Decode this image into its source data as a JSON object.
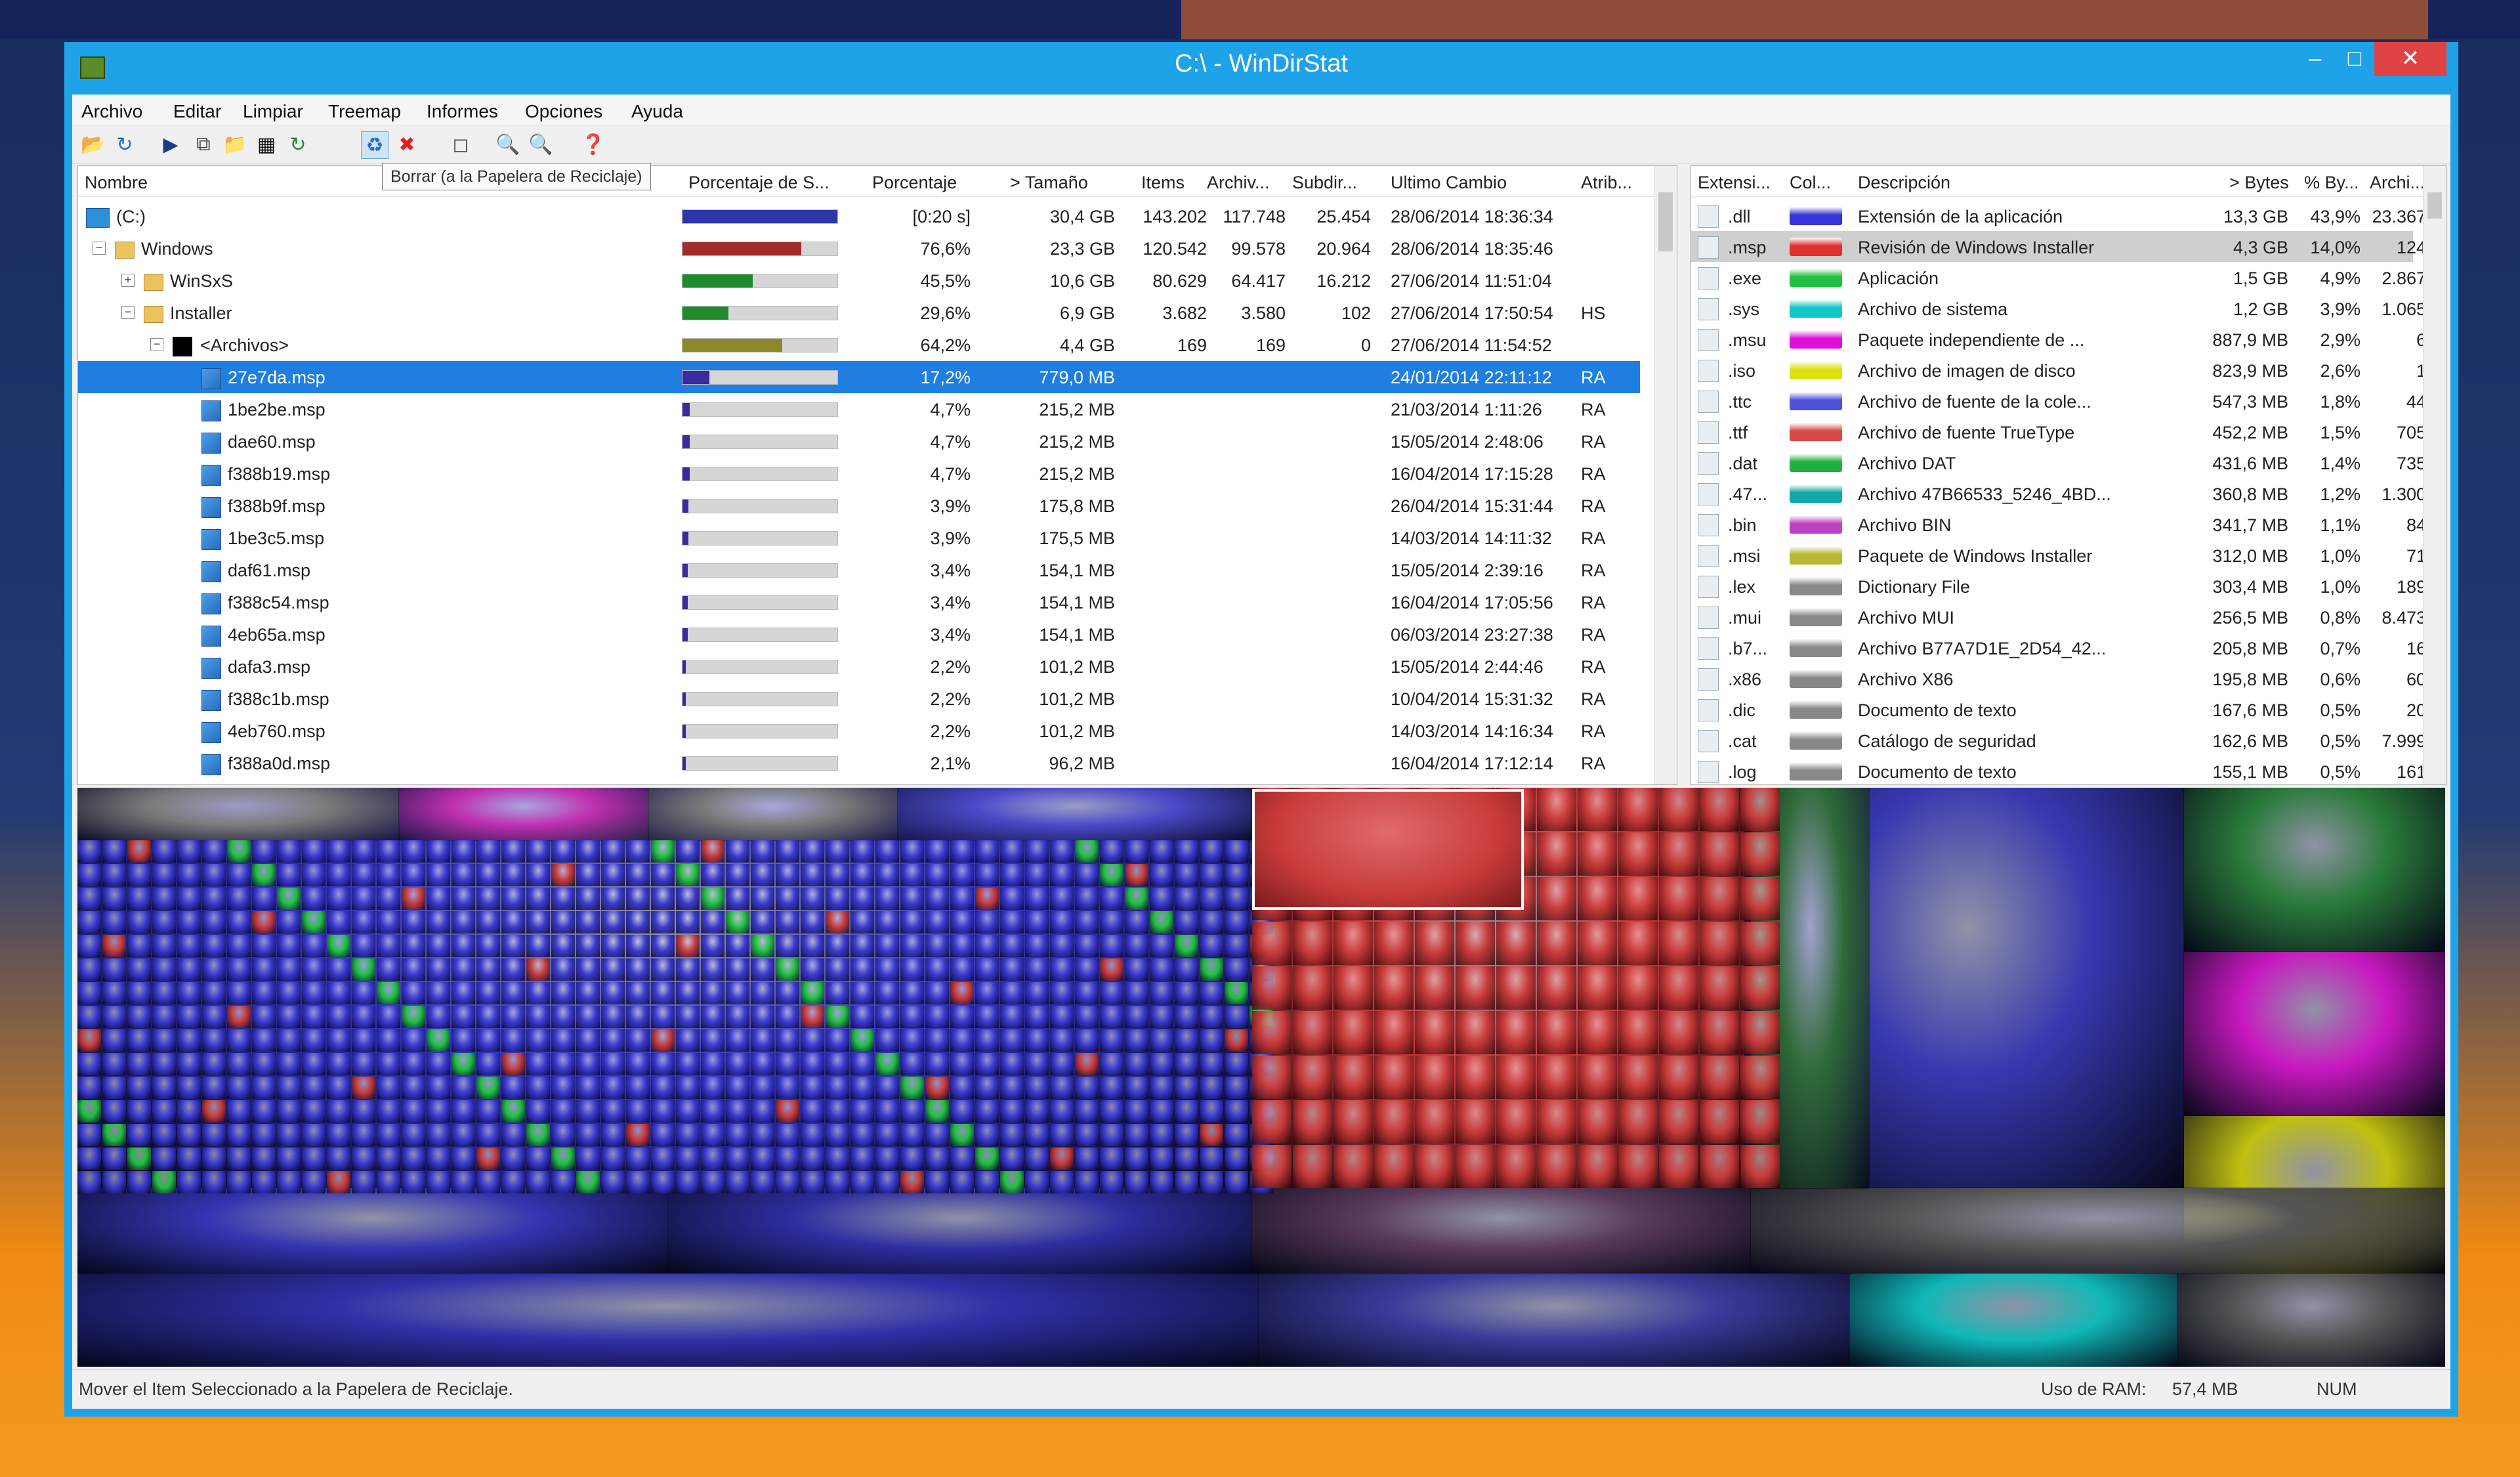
{
  "window": {
    "title": "C:\\ - WinDirStat"
  },
  "menu": [
    "Archivo",
    "Editar",
    "Limpiar",
    "Treemap",
    "Informes",
    "Opciones",
    "Ayuda"
  ],
  "toolbar": {
    "icons": [
      "open-icon",
      "refresh-icon",
      "play-icon",
      "copy-path-icon",
      "explorer-icon",
      "cmd-icon",
      "refresh-selected-icon",
      "recycle-bin-icon",
      "delete-icon",
      "properties-icon",
      "zoom-in-icon",
      "zoom-out-icon",
      "help-icon"
    ],
    "tooltip": "Borrar (a la Papelera de Reciclaje)"
  },
  "tree": {
    "columns": [
      "Nombre",
      "Porcentaje de S...",
      "Porcentaje",
      "> Tamaño",
      "Items",
      "Archiv...",
      "Subdir...",
      "Ultimo Cambio",
      "Atrib..."
    ],
    "rows": [
      {
        "name": "(C:)",
        "pct": "[0:20 s]",
        "size": "30,4 GB",
        "items": "143.202",
        "files": "117.748",
        "subdirs": "25.454",
        "date": "28/06/2014  18:36:34",
        "attr": "",
        "bar": 1.0,
        "color": "#2e35a8"
      },
      {
        "name": "Windows",
        "pct": "76,6%",
        "size": "23,3 GB",
        "items": "120.542",
        "files": "99.578",
        "subdirs": "20.964",
        "date": "28/06/2014  18:35:46",
        "attr": "",
        "bar": 0.766,
        "color": "#a02c2c"
      },
      {
        "name": "WinSxS",
        "pct": "45,5%",
        "size": "10,6 GB",
        "items": "80.629",
        "files": "64.417",
        "subdirs": "16.212",
        "date": "27/06/2014  11:51:04",
        "attr": "",
        "bar": 0.455,
        "color": "#1f8a2e"
      },
      {
        "name": "Installer",
        "pct": "29,6%",
        "size": "6,9 GB",
        "items": "3.682",
        "files": "3.580",
        "subdirs": "102",
        "date": "27/06/2014  17:50:54",
        "attr": "HS",
        "bar": 0.296,
        "color": "#1f8a2e"
      },
      {
        "name": "<Archivos>",
        "pct": "64,2%",
        "size": "4,4 GB",
        "items": "169",
        "files": "169",
        "subdirs": "0",
        "date": "27/06/2014  11:54:52",
        "attr": "",
        "bar": 0.642,
        "color": "#8a8a2a"
      },
      {
        "name": "27e7da.msp",
        "pct": "17,2%",
        "size": "779,0 MB",
        "items": "",
        "files": "",
        "subdirs": "",
        "date": "24/01/2014  22:11:12",
        "attr": "RA",
        "bar": 0.172,
        "color": "#3a2aa0"
      },
      {
        "name": "1be2be.msp",
        "pct": "4,7%",
        "size": "215,2 MB",
        "items": "",
        "files": "",
        "subdirs": "",
        "date": "21/03/2014  1:11:26",
        "attr": "RA",
        "bar": 0.047,
        "color": "#3a2aa0"
      },
      {
        "name": "dae60.msp",
        "pct": "4,7%",
        "size": "215,2 MB",
        "items": "",
        "files": "",
        "subdirs": "",
        "date": "15/05/2014  2:48:06",
        "attr": "RA",
        "bar": 0.047,
        "color": "#3a2aa0"
      },
      {
        "name": "f388b19.msp",
        "pct": "4,7%",
        "size": "215,2 MB",
        "items": "",
        "files": "",
        "subdirs": "",
        "date": "16/04/2014  17:15:28",
        "attr": "RA",
        "bar": 0.047,
        "color": "#3a2aa0"
      },
      {
        "name": "f388b9f.msp",
        "pct": "3,9%",
        "size": "175,8 MB",
        "items": "",
        "files": "",
        "subdirs": "",
        "date": "26/04/2014  15:31:44",
        "attr": "RA",
        "bar": 0.039,
        "color": "#3a2aa0"
      },
      {
        "name": "1be3c5.msp",
        "pct": "3,9%",
        "size": "175,5 MB",
        "items": "",
        "files": "",
        "subdirs": "",
        "date": "14/03/2014  14:11:32",
        "attr": "RA",
        "bar": 0.039,
        "color": "#3a2aa0"
      },
      {
        "name": "daf61.msp",
        "pct": "3,4%",
        "size": "154,1 MB",
        "items": "",
        "files": "",
        "subdirs": "",
        "date": "15/05/2014  2:39:16",
        "attr": "RA",
        "bar": 0.034,
        "color": "#3a2aa0"
      },
      {
        "name": "f388c54.msp",
        "pct": "3,4%",
        "size": "154,1 MB",
        "items": "",
        "files": "",
        "subdirs": "",
        "date": "16/04/2014  17:05:56",
        "attr": "RA",
        "bar": 0.034,
        "color": "#3a2aa0"
      },
      {
        "name": "4eb65a.msp",
        "pct": "3,4%",
        "size": "154,1 MB",
        "items": "",
        "files": "",
        "subdirs": "",
        "date": "06/03/2014  23:27:38",
        "attr": "RA",
        "bar": 0.034,
        "color": "#3a2aa0"
      },
      {
        "name": "dafa3.msp",
        "pct": "2,2%",
        "size": "101,2 MB",
        "items": "",
        "files": "",
        "subdirs": "",
        "date": "15/05/2014  2:44:46",
        "attr": "RA",
        "bar": 0.022,
        "color": "#3a2aa0"
      },
      {
        "name": "f388c1b.msp",
        "pct": "2,2%",
        "size": "101,2 MB",
        "items": "",
        "files": "",
        "subdirs": "",
        "date": "10/04/2014  15:31:32",
        "attr": "RA",
        "bar": 0.022,
        "color": "#3a2aa0"
      },
      {
        "name": "4eb760.msp",
        "pct": "2,2%",
        "size": "101,2 MB",
        "items": "",
        "files": "",
        "subdirs": "",
        "date": "14/03/2014  14:16:34",
        "attr": "RA",
        "bar": 0.022,
        "color": "#3a2aa0"
      },
      {
        "name": "f388a0d.msp",
        "pct": "2,1%",
        "size": "96,2 MB",
        "items": "",
        "files": "",
        "subdirs": "",
        "date": "16/04/2014  17:12:14",
        "attr": "RA",
        "bar": 0.021,
        "color": "#3a2aa0"
      }
    ]
  },
  "extensions": {
    "columns": [
      "Extensi...",
      "Col...",
      "Descripción",
      "> Bytes",
      "% By...",
      "Archi..."
    ],
    "rows": [
      {
        "ext": ".dll",
        "desc": "Extensión de la aplicación",
        "bytes": "13,3 GB",
        "pct": "43,9%",
        "files": "23.367",
        "color": "#3434d8"
      },
      {
        "ext": ".msp",
        "desc": "Revisión de Windows Installer",
        "bytes": "4,3 GB",
        "pct": "14,0%",
        "files": "124",
        "color": "#e03030"
      },
      {
        "ext": ".exe",
        "desc": "Aplicación",
        "bytes": "1,5 GB",
        "pct": "4,9%",
        "files": "2.867",
        "color": "#20c040"
      },
      {
        "ext": ".sys",
        "desc": "Archivo de sistema",
        "bytes": "1,2 GB",
        "pct": "3,9%",
        "files": "1.065",
        "color": "#10c8c8"
      },
      {
        "ext": ".msu",
        "desc": "Paquete independiente de ...",
        "bytes": "887,9 MB",
        "pct": "2,9%",
        "files": "6",
        "color": "#e010d8"
      },
      {
        "ext": ".iso",
        "desc": "Archivo de imagen de disco",
        "bytes": "823,9 MB",
        "pct": "2,6%",
        "files": "1",
        "color": "#e0e010"
      },
      {
        "ext": ".ttc",
        "desc": "Archivo de fuente de la cole...",
        "bytes": "547,3 MB",
        "pct": "1,8%",
        "files": "44",
        "color": "#5050d8"
      },
      {
        "ext": ".ttf",
        "desc": "Archivo de fuente TrueType",
        "bytes": "452,2 MB",
        "pct": "1,5%",
        "files": "705",
        "color": "#d84848"
      },
      {
        "ext": ".dat",
        "desc": "Archivo DAT",
        "bytes": "431,6 MB",
        "pct": "1,4%",
        "files": "735",
        "color": "#20b040"
      },
      {
        "ext": ".47...",
        "desc": "Archivo 47B66533_5246_4BD...",
        "bytes": "360,8 MB",
        "pct": "1,2%",
        "files": "1.300",
        "color": "#10a8a8"
      },
      {
        "ext": ".bin",
        "desc": "Archivo BIN",
        "bytes": "341,7 MB",
        "pct": "1,1%",
        "files": "84",
        "color": "#c040c8"
      },
      {
        "ext": ".msi",
        "desc": "Paquete de Windows Installer",
        "bytes": "312,0 MB",
        "pct": "1,0%",
        "files": "71",
        "color": "#b8b830"
      },
      {
        "ext": ".lex",
        "desc": "Dictionary File",
        "bytes": "303,4 MB",
        "pct": "1,0%",
        "files": "189",
        "color": "#888888"
      },
      {
        "ext": ".mui",
        "desc": "Archivo MUI",
        "bytes": "256,5 MB",
        "pct": "0,8%",
        "files": "8.473",
        "color": "#888888"
      },
      {
        "ext": ".b7...",
        "desc": "Archivo B77A7D1E_2D54_42...",
        "bytes": "205,8 MB",
        "pct": "0,7%",
        "files": "16",
        "color": "#888888"
      },
      {
        "ext": ".x86",
        "desc": "Archivo X86",
        "bytes": "195,8 MB",
        "pct": "0,6%",
        "files": "60",
        "color": "#888888"
      },
      {
        "ext": ".dic",
        "desc": "Documento de texto",
        "bytes": "167,6 MB",
        "pct": "0,5%",
        "files": "20",
        "color": "#888888"
      },
      {
        "ext": ".cat",
        "desc": "Catálogo de seguridad",
        "bytes": "162,6 MB",
        "pct": "0,5%",
        "files": "7.999",
        "color": "#888888"
      },
      {
        "ext": ".log",
        "desc": "Documento de texto",
        "bytes": "155,1 MB",
        "pct": "0,5%",
        "files": "161",
        "color": "#888888"
      }
    ]
  },
  "status": {
    "message": "Mover el Item Seleccionado a la Papelera de Reciclaje.",
    "ram_label": "Uso de RAM:",
    "ram_value": "57,4 MB",
    "num": "NUM"
  },
  "colors": {
    "selection": "#1e7fe0",
    "titlebar": "#1ea2e8",
    "close": "#e04343"
  }
}
